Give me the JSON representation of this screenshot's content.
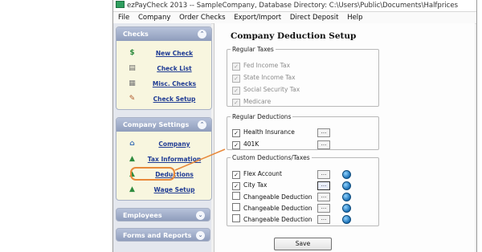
{
  "window": {
    "title": "ezPayCheck 2013 -- SampleCompany, Database Directory: C:\\Users\\Public\\Documents\\Halfprices"
  },
  "menu": [
    {
      "label": "File"
    },
    {
      "label": "Company"
    },
    {
      "label": "Order Checks"
    },
    {
      "label": "Export/Import"
    },
    {
      "label": "Direct Deposit"
    },
    {
      "label": "Help"
    }
  ],
  "sidebar": {
    "checks": {
      "title": "Checks",
      "items": [
        {
          "label": "New Check",
          "icon": "dollar-icon"
        },
        {
          "label": "Check List",
          "icon": "list-icon"
        },
        {
          "label": "Misc. Checks",
          "icon": "checks-icon"
        },
        {
          "label": "Check Setup",
          "icon": "pencil-icon"
        }
      ]
    },
    "company_settings": {
      "title": "Company Settings",
      "items": [
        {
          "label": "Company",
          "icon": "home-icon"
        },
        {
          "label": "Tax Information",
          "icon": "tax-icon"
        },
        {
          "label": "Deductions",
          "icon": "deductions-icon"
        },
        {
          "label": "Wage Setup",
          "icon": "wage-icon"
        }
      ]
    },
    "employees": {
      "title": "Employees"
    },
    "forms_reports": {
      "title": "Forms and Reports"
    }
  },
  "content": {
    "title": "Company Deduction Setup",
    "regular_taxes": {
      "legend": "Regular Taxes",
      "items": [
        {
          "label": "Fed Income Tax",
          "checked": true
        },
        {
          "label": "State Income Tax",
          "checked": true
        },
        {
          "label": "Social Security Tax",
          "checked": true
        },
        {
          "label": "Medicare",
          "checked": true
        }
      ]
    },
    "regular_deductions": {
      "legend": "Regular Deductions",
      "items": [
        {
          "label": "Health Insurance",
          "checked": true,
          "button": "..."
        },
        {
          "label": "401K",
          "checked": true,
          "button": "..."
        }
      ]
    },
    "custom_deductions": {
      "legend": "Custom Deductions/Taxes",
      "items": [
        {
          "label": "Flex Account",
          "checked": true,
          "button": "..."
        },
        {
          "label": "City Tax",
          "checked": true,
          "button": "..."
        },
        {
          "label": "Changeable Deduction",
          "checked": false,
          "button": "..."
        },
        {
          "label": "Changeable Deduction",
          "checked": false,
          "button": "..."
        },
        {
          "label": "Changeable Deduction",
          "checked": false,
          "button": "..."
        }
      ]
    },
    "save_label": "Save"
  },
  "colors": {
    "highlight": "#e8893a",
    "nav_link": "#1f3b94",
    "panel_header": "#8f9dbc"
  }
}
